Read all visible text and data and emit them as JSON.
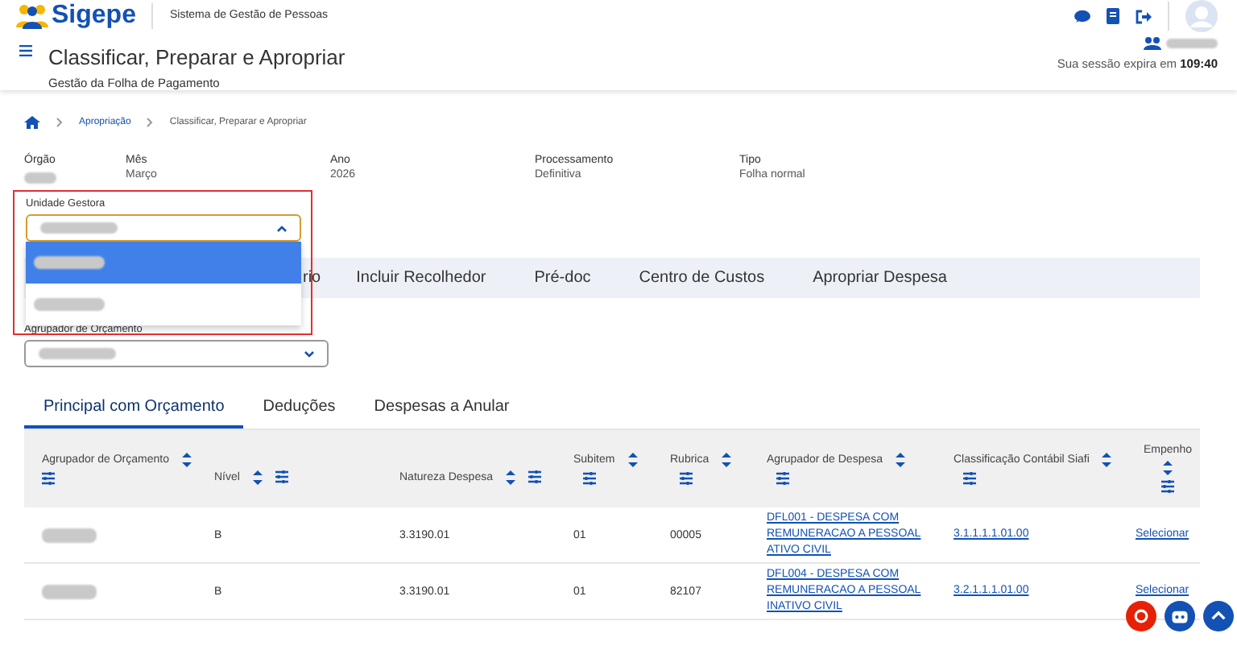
{
  "header": {
    "logo": "Sigepe",
    "system": "Sistema de Gestão de Pessoas",
    "title": "Classificar, Preparar e Apropriar",
    "subtitle": "Gestão da Folha de Pagamento",
    "session_label": "Sua sessão expira em",
    "session_time": "109:40"
  },
  "breadcrumb": [
    "Apropriação",
    "Classificar, Preparar e Apropriar"
  ],
  "info": [
    {
      "label": "Órgão"
    },
    {
      "label": "Mês",
      "value": "Março"
    },
    {
      "label": "Ano",
      "value": "2026"
    },
    {
      "label": "Processamento",
      "value": "Definitiva"
    },
    {
      "label": "Tipo",
      "value": "Folha normal"
    }
  ],
  "unidade_gestora": {
    "label": "Unidade Gestora",
    "expanded": true,
    "highlighted": true,
    "options": [
      {
        "selected": true
      },
      {
        "selected": false
      }
    ]
  },
  "step_tabs": [
    "rio",
    "Incluir Recolhedor",
    "Pré-doc",
    "Centro de Custos",
    "Apropriar Despesa"
  ],
  "agrupador": {
    "label": "Agrupador de Orçamento",
    "expanded": false
  },
  "sub_tabs": [
    {
      "label": "Principal com Orçamento",
      "selected": true
    },
    {
      "label": "Deduções",
      "selected": false
    },
    {
      "label": "Despesas a Anular",
      "selected": false
    }
  ],
  "table": {
    "columns": [
      "Agrupador de Orçamento",
      "Nível",
      "Natureza Despesa",
      "Subitem",
      "Rubrica",
      "Agrupador de Despesa",
      "Classificação Contábil Siafi",
      "Empenho"
    ],
    "rows": [
      [
        {
          "kind": "redacted"
        },
        {
          "kind": "text",
          "text": "B"
        },
        {
          "kind": "text",
          "text": "3.3190.01"
        },
        {
          "kind": "text",
          "text": "01"
        },
        {
          "kind": "text",
          "text": "00005"
        },
        {
          "kind": "link",
          "text": "DFL001 - DESPESA COM REMUNERACAO A PESSOAL ATIVO CIVIL"
        },
        {
          "kind": "link",
          "text": "3.1.1.1.1.01.00"
        },
        {
          "kind": "link",
          "text": "Selecionar"
        }
      ],
      [
        {
          "kind": "redacted"
        },
        {
          "kind": "text",
          "text": "B"
        },
        {
          "kind": "text",
          "text": "3.3190.01"
        },
        {
          "kind": "text",
          "text": "01"
        },
        {
          "kind": "text",
          "text": "82107"
        },
        {
          "kind": "link",
          "text": "DFL004 - DESPESA COM REMUNERACAO A PESSOAL INATIVO CIVIL"
        },
        {
          "kind": "link",
          "text": "3.2.1.1.1.01.00"
        },
        {
          "kind": "link",
          "text": "Selecionar"
        }
      ]
    ]
  }
}
